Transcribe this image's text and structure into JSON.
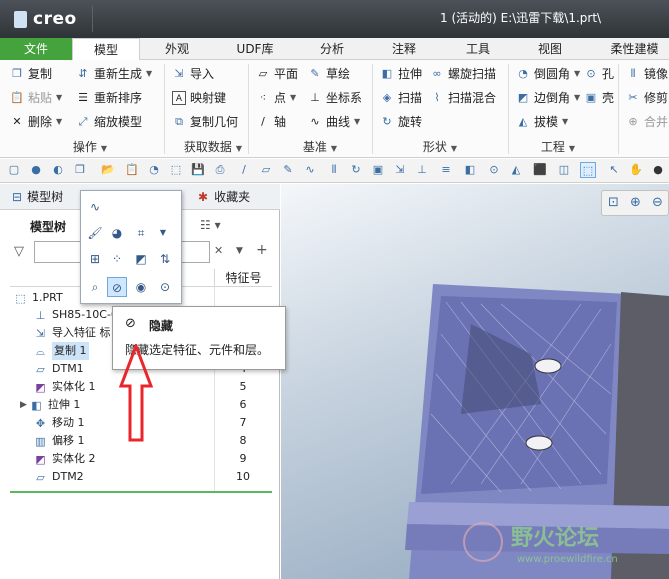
{
  "window": {
    "app_name": "creo",
    "title": "1 (活动的) E:\\迅雷下载\\1.prt\\"
  },
  "tabs": [
    "文件",
    "模型",
    "外观",
    "UDF库",
    "分析",
    "注释",
    "工具",
    "视图",
    "柔性建模"
  ],
  "ribbon": {
    "ops": {
      "copy": "复制",
      "paste": "粘贴",
      "delete": "删除",
      "regen": "重新生成",
      "reorder": "重新排序",
      "scale": "缩放模型",
      "group": "操作"
    },
    "getdata": {
      "import": "导入",
      "mapkey": "映射键",
      "copygeom": "复制几何",
      "group": "获取数据"
    },
    "datum": {
      "plane": "平面",
      "point": "点",
      "axis": "轴",
      "sketch": "草绘",
      "csys": "坐标系",
      "curve": "曲线",
      "group": "基准"
    },
    "shape": {
      "extrude": "拉伸",
      "helical": "螺旋扫描",
      "sweep": "扫描",
      "blend": "扫描混合",
      "revolve": "旋转",
      "group": "形状"
    },
    "eng": {
      "round": "倒圆角",
      "hole": "孔",
      "chamfer": "边倒角",
      "shell": "壳",
      "draft": "拔模",
      "group": "工程"
    },
    "edit": {
      "mirror": "镜像",
      "trim": "修剪",
      "merge": "合并"
    }
  },
  "left_panel": {
    "tab_tree": "模型树",
    "tab_fav": "收藏夹",
    "tree_header": "模型树",
    "col_feature": "特征号",
    "rows": [
      {
        "label": "1.PRT",
        "num": ""
      },
      {
        "label": "SH85-10C-6",
        "num": ""
      },
      {
        "label": "导入特征 标",
        "num": ""
      },
      {
        "label": "复制 1",
        "num": ""
      },
      {
        "label": "DTM1",
        "num": "4"
      },
      {
        "label": "实体化 1",
        "num": "5"
      },
      {
        "label": "拉伸 1",
        "num": "6"
      },
      {
        "label": "移动 1",
        "num": "7"
      },
      {
        "label": "偏移 1",
        "num": "8"
      },
      {
        "label": "实体化 2",
        "num": "9"
      },
      {
        "label": "DTM2",
        "num": "10"
      }
    ]
  },
  "tooltip": {
    "title": "隐藏",
    "desc": "隐藏选定特征、元件和层。"
  },
  "watermark": {
    "text": "野火论坛",
    "url": "www.proewildfire.cn"
  },
  "colors": {
    "file_tab": "#45a33d",
    "arrow": "#e8262b",
    "model_face": "#6f78b8"
  }
}
